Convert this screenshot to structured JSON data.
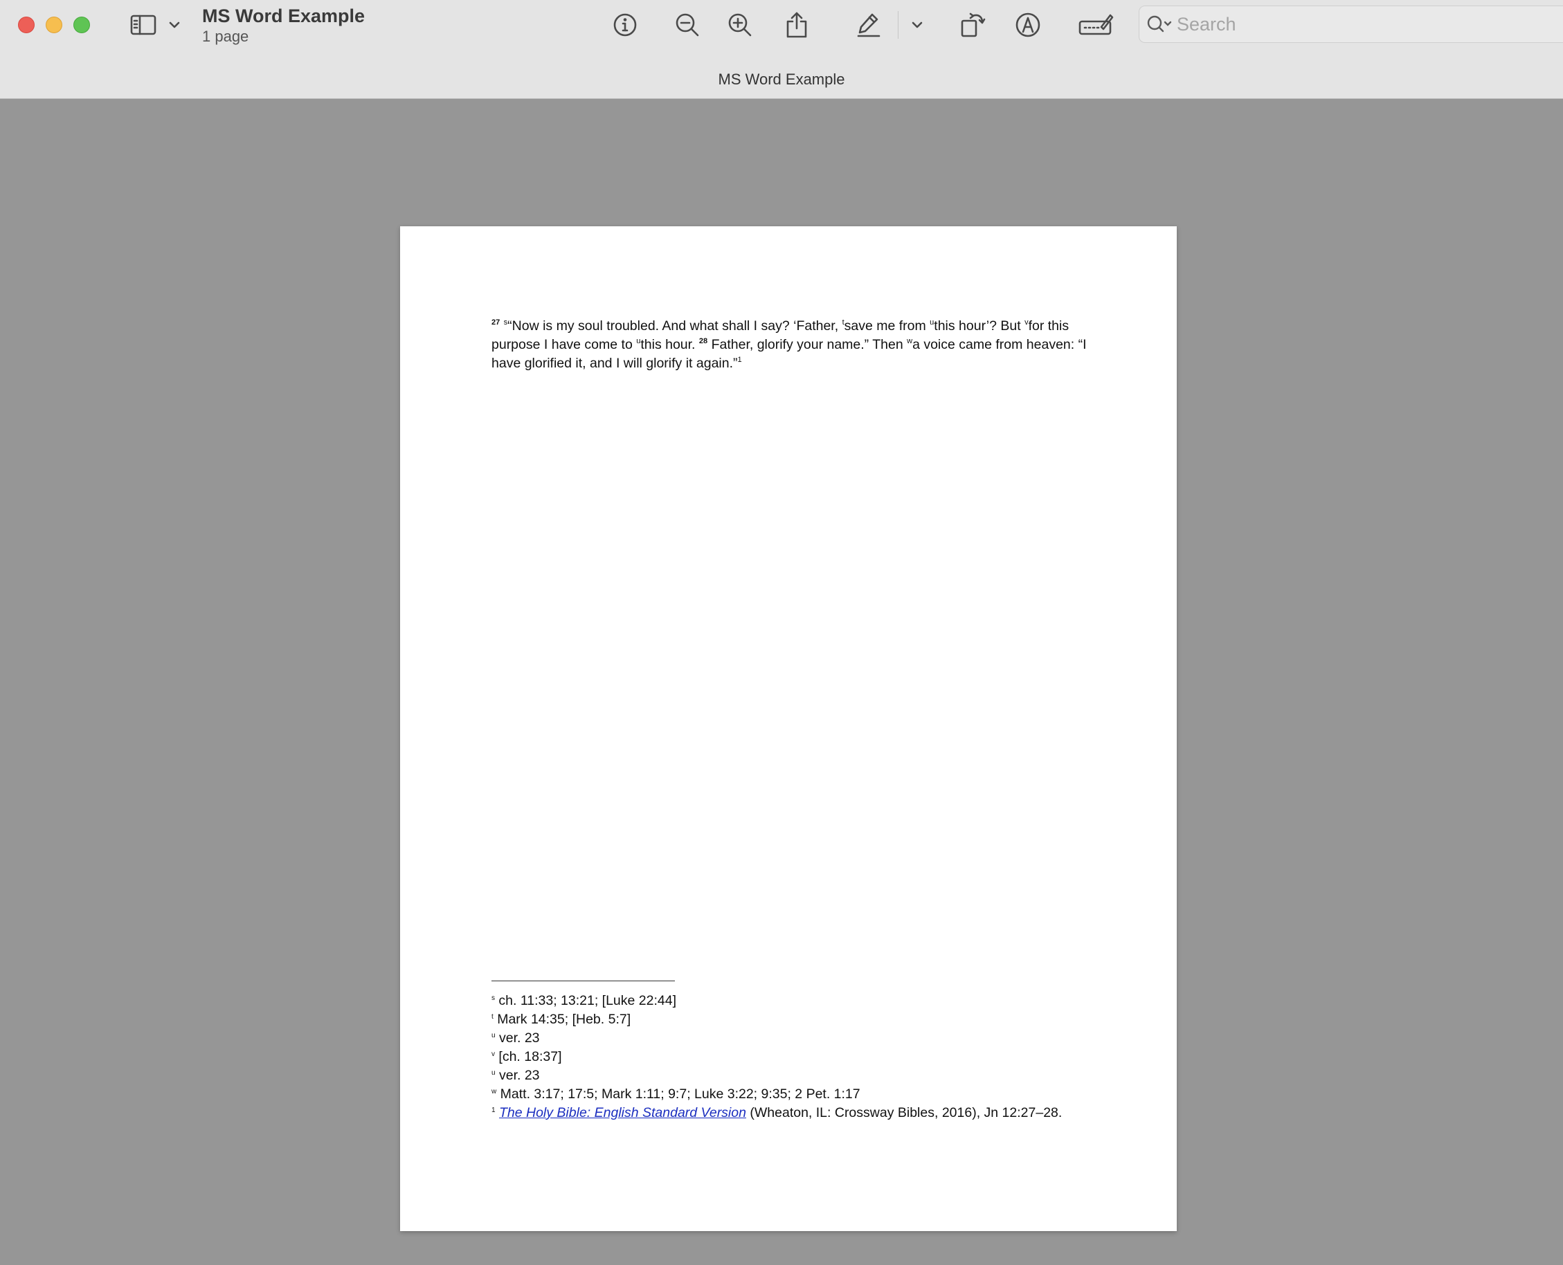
{
  "window": {
    "document_title": "MS Word Example",
    "page_count": "1 page",
    "caption": "MS Word Example"
  },
  "toolbar": {
    "search_placeholder": "Search",
    "icons": [
      "sidebar-icon",
      "chevron-down-icon",
      "info-icon",
      "zoom-out-icon",
      "zoom-in-icon",
      "share-icon",
      "highlight-pen-icon",
      "chevron-down-icon",
      "rotate-icon",
      "markup-icon",
      "signature-icon",
      "search-icon"
    ]
  },
  "document": {
    "passage": {
      "verse27": "27",
      "fn_s": "s",
      "t1": "“Now is my soul troubled. And what shall I say? ‘Father, ",
      "fn_t": "t",
      "t2": "save me from ",
      "fn_u1": "u",
      "t3": "this hour’? But ",
      "fn_v": "v",
      "t4": "for this purpose I have come to ",
      "fn_u2": "u",
      "t5": "this hour. ",
      "verse28": "28",
      "t6": " Father, glorify your name.” Then ",
      "fn_w": "w",
      "t7": "a voice came from heaven: “I have glorified it, and I will glorify it again.”",
      "fn_1": "1"
    },
    "footnotes": [
      {
        "mark": "s",
        "text": "ch. 11:33; 13:21; [Luke 22:44]"
      },
      {
        "mark": "t",
        "text": "Mark 14:35; [Heb. 5:7]"
      },
      {
        "mark": "u",
        "text": "ver. 23"
      },
      {
        "mark": "v",
        "text": "[ch. 18:37]"
      },
      {
        "mark": "u",
        "text": "ver. 23"
      },
      {
        "mark": "w",
        "text": "Matt. 3:17; 17:5; Mark 1:11; 9:7; Luke 3:22; 9:35; 2 Pet. 1:17"
      }
    ],
    "source_note": {
      "mark": "1",
      "link_text": "The Holy Bible: English Standard Version",
      "rest": " (Wheaton, IL: Crossway Bibles, 2016), Jn 12:27–28."
    }
  },
  "colors": {
    "background": "#969696",
    "toolbar": "#e4e4e4",
    "link": "#1a2dbf"
  }
}
